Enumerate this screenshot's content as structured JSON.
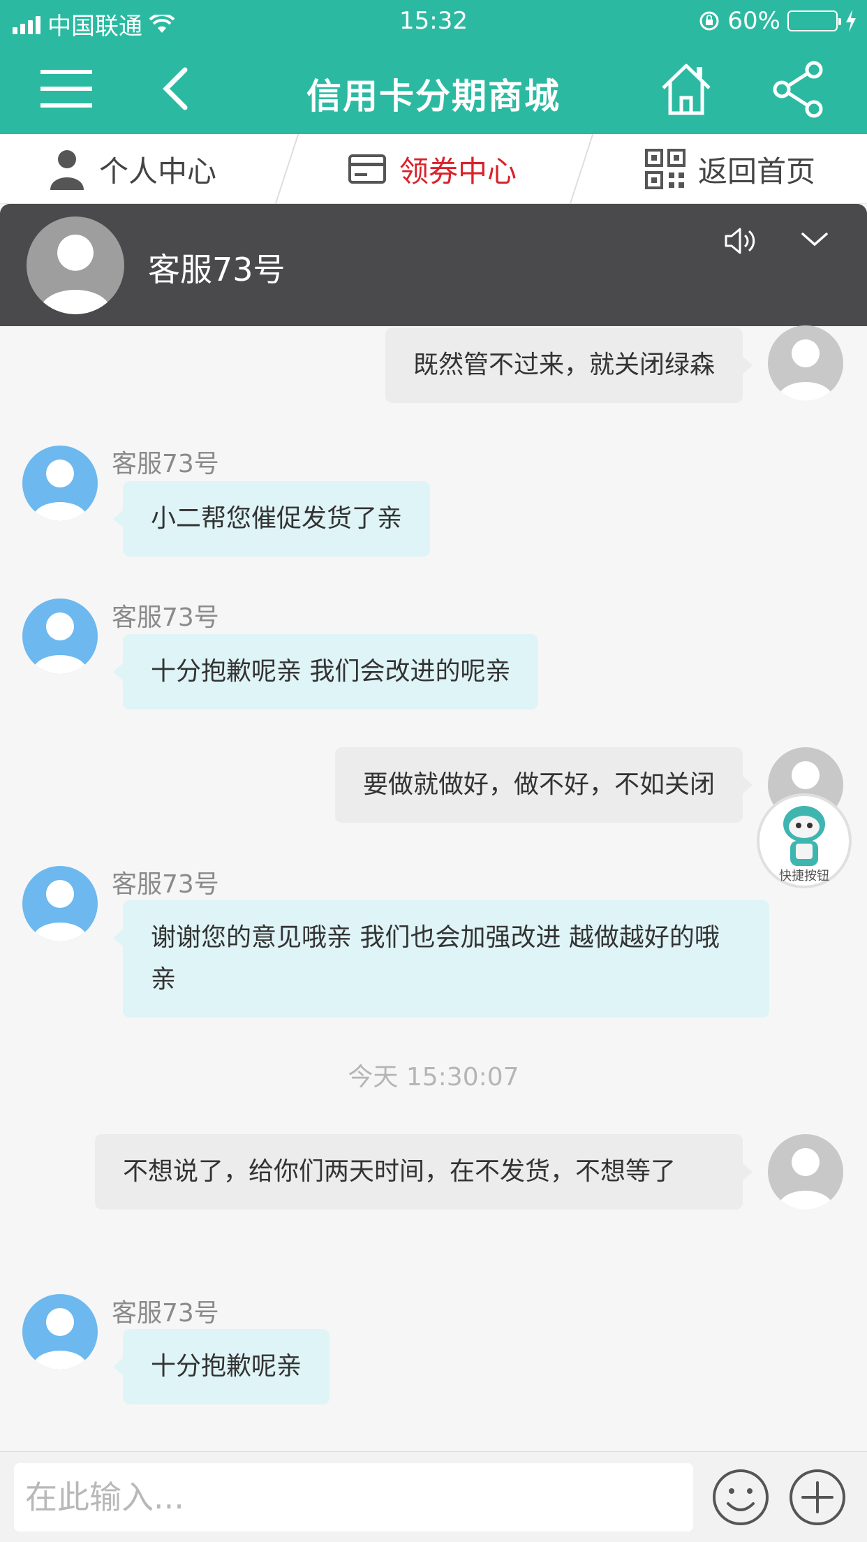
{
  "status_bar": {
    "carrier": "中国联通",
    "time": "15:32",
    "battery": "60%",
    "battery_level": 0.6
  },
  "nav": {
    "title": "信用卡分期商城",
    "menu_icon": "hamburger-menu-icon",
    "back_icon": "chevron-left-icon",
    "home_icon": "home-icon",
    "share_icon": "share-icon"
  },
  "subtabs": [
    {
      "label": "个人中心",
      "icon": "person-icon"
    },
    {
      "label": "领券中心",
      "icon": "card-icon",
      "active": true
    },
    {
      "label": "返回首页",
      "icon": "qr-code-icon"
    }
  ],
  "chat_header": {
    "agent_name": "客服73号",
    "sound_icon": "speaker-icon",
    "collapse_icon": "chevron-down-icon"
  },
  "messages": [
    {
      "from": "me",
      "text": "既然管不过来，就关闭绿森"
    },
    {
      "from": "agent",
      "sender": "客服73号",
      "text": "小二帮您催促发货了亲"
    },
    {
      "from": "agent",
      "sender": "客服73号",
      "text": "十分抱歉呢亲 我们会改进的呢亲"
    },
    {
      "from": "me",
      "text": "要做就做好，做不好，不如关闭"
    },
    {
      "from": "agent",
      "sender": "客服73号",
      "text": "谢谢您的意见哦亲 我们也会加强改进 越做越好的哦亲"
    },
    {
      "from": "me",
      "text": "不想说了，给你们两天时间，在不发货，不想等了"
    },
    {
      "from": "agent",
      "sender": "客服73号",
      "text": "十分抱歉呢亲"
    }
  ],
  "timestamp": "今天 15:30:07",
  "quick_button": {
    "label": "快捷按钮"
  },
  "input": {
    "placeholder": "在此输入...",
    "emoji_icon": "smiley-icon",
    "plus_icon": "plus-icon"
  },
  "colors": {
    "brand": "#2bbaa1",
    "active_tab": "#d9222a",
    "header_dark": "#4a4a4c",
    "agent_bubble": "#dff4f6",
    "user_bubble": "#ececec"
  }
}
